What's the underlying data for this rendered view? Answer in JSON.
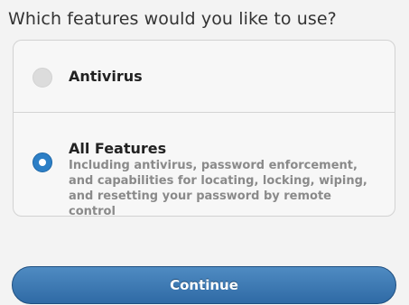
{
  "question": "Which features would you like to use?",
  "options": [
    {
      "label": "Antivirus",
      "description": "",
      "selected": false
    },
    {
      "label": "All Features",
      "description": "Including antivirus, password enforcement, and capabilities for locating, locking, wiping, and resetting your password by remote control",
      "selected": true
    }
  ],
  "continue_label": "Continue",
  "colors": {
    "accent": "#2d7fc6",
    "button": "#3a75b0"
  }
}
